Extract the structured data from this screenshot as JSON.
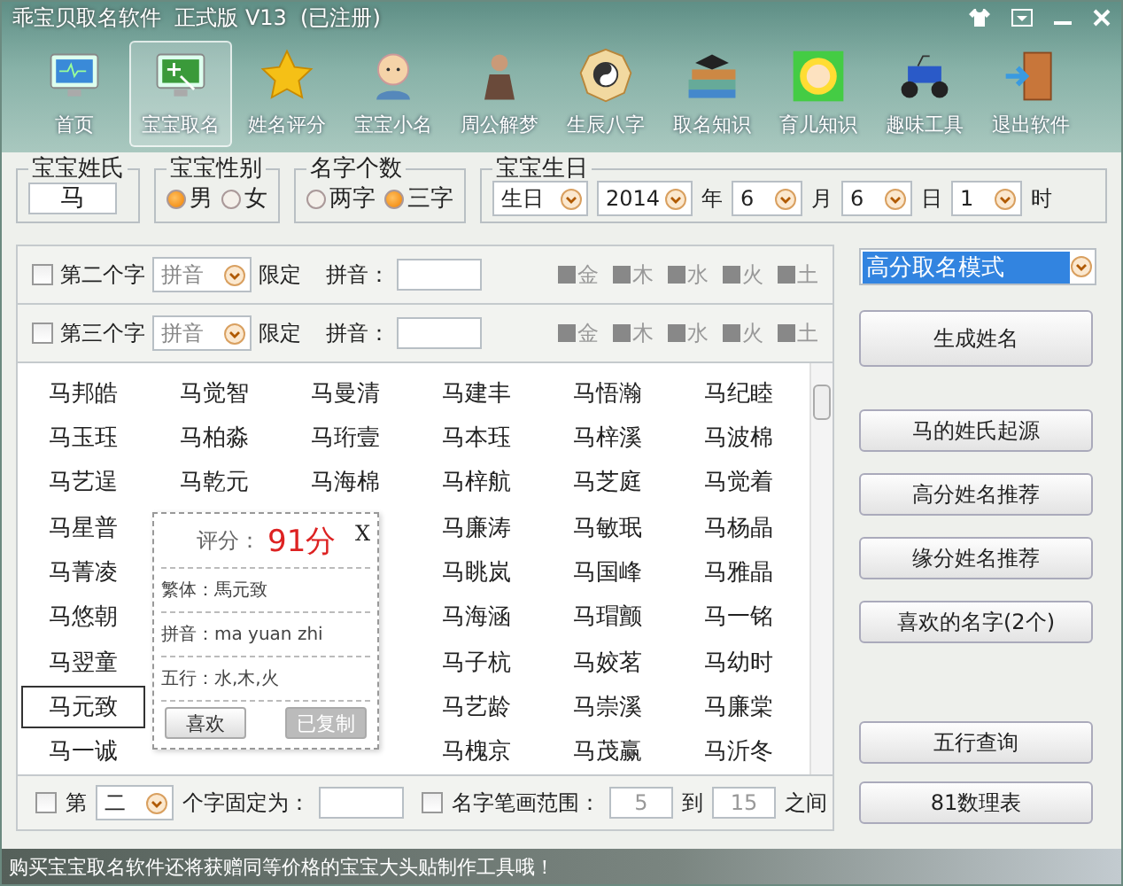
{
  "window": {
    "title": "乖宝贝取名软件  正式版 V13  (已注册)"
  },
  "toolbar": [
    {
      "label": "首页",
      "selected": false
    },
    {
      "label": "宝宝取名",
      "selected": true
    },
    {
      "label": "姓名评分",
      "selected": false
    },
    {
      "label": "宝宝小名",
      "selected": false
    },
    {
      "label": "周公解梦",
      "selected": false
    },
    {
      "label": "生辰八字",
      "selected": false
    },
    {
      "label": "取名知识",
      "selected": false
    },
    {
      "label": "育儿知识",
      "selected": false
    },
    {
      "label": "趣味工具",
      "selected": false
    },
    {
      "label": "退出软件",
      "selected": false
    }
  ],
  "surname": {
    "label": "宝宝姓氏",
    "value": "马"
  },
  "gender": {
    "label": "宝宝性别",
    "options": [
      {
        "label": "男",
        "selected": true
      },
      {
        "label": "女",
        "selected": false
      }
    ]
  },
  "name_length": {
    "label": "名字个数",
    "options": [
      {
        "label": "两字",
        "selected": false
      },
      {
        "label": "三字",
        "selected": true
      }
    ]
  },
  "birthday": {
    "label": "宝宝生日",
    "fields": [
      {
        "value": "生日"
      },
      {
        "value": "2014",
        "unit": "年"
      },
      {
        "value": "6",
        "unit": "月"
      },
      {
        "value": "6",
        "unit": "日"
      },
      {
        "value": "1",
        "unit": "时"
      }
    ]
  },
  "char_filters": [
    {
      "label": "第二个字",
      "checked": false,
      "select": "拼音",
      "limit_label": "限定",
      "pinyin_label": "拼音：",
      "elements": [
        {
          "label": "金",
          "checked": false
        },
        {
          "label": "木",
          "checked": false
        },
        {
          "label": "水",
          "checked": false
        },
        {
          "label": "火",
          "checked": false
        },
        {
          "label": "土",
          "checked": false
        }
      ]
    },
    {
      "label": "第三个字",
      "checked": false,
      "select": "拼音",
      "limit_label": "限定",
      "pinyin_label": "拼音：",
      "elements": [
        {
          "label": "金",
          "checked": false
        },
        {
          "label": "木",
          "checked": false
        },
        {
          "label": "水",
          "checked": false
        },
        {
          "label": "火",
          "checked": false
        },
        {
          "label": "土",
          "checked": false
        }
      ]
    }
  ],
  "names": [
    {
      "cells": [
        {
          "text": "马邦皓",
          "selected": false
        },
        {
          "text": "马觉智",
          "selected": false
        },
        {
          "text": "马曼清",
          "selected": false
        },
        {
          "text": "马建丰",
          "selected": false
        },
        {
          "text": "马悟瀚",
          "selected": false
        },
        {
          "text": "马纪睦",
          "selected": false
        }
      ]
    },
    {
      "cells": [
        {
          "text": "马玉珏",
          "selected": false
        },
        {
          "text": "马柏淼",
          "selected": false
        },
        {
          "text": "马珩壹",
          "selected": false
        },
        {
          "text": "马本珏",
          "selected": false
        },
        {
          "text": "马梓溪",
          "selected": false
        },
        {
          "text": "马波棉",
          "selected": false
        }
      ]
    },
    {
      "cells": [
        {
          "text": "马艺逞",
          "selected": false
        },
        {
          "text": "马乾元",
          "selected": false
        },
        {
          "text": "马海棉",
          "selected": false
        },
        {
          "text": "马梓航",
          "selected": false
        },
        {
          "text": "马芝庭",
          "selected": false
        },
        {
          "text": "马觉着",
          "selected": false
        }
      ]
    },
    {
      "cells": [
        {
          "text": "马星普",
          "selected": false
        },
        null,
        null,
        {
          "text": "马廉涛",
          "selected": false
        },
        {
          "text": "马敏珉",
          "selected": false
        },
        {
          "text": "马杨晶",
          "selected": false
        }
      ]
    },
    {
      "cells": [
        {
          "text": "马菁凌",
          "selected": false
        },
        null,
        null,
        {
          "text": "马眺岚",
          "selected": false
        },
        {
          "text": "马国峰",
          "selected": false
        },
        {
          "text": "马雅晶",
          "selected": false
        }
      ]
    },
    {
      "cells": [
        {
          "text": "马悠朝",
          "selected": false
        },
        null,
        null,
        {
          "text": "马海涵",
          "selected": false
        },
        {
          "text": "马瑁颤",
          "selected": false
        },
        {
          "text": "马一铭",
          "selected": false
        }
      ]
    },
    {
      "cells": [
        {
          "text": "马翌童",
          "selected": false
        },
        null,
        null,
        {
          "text": "马子杭",
          "selected": false
        },
        {
          "text": "马姣茗",
          "selected": false
        },
        {
          "text": "马幼时",
          "selected": false
        }
      ]
    },
    {
      "cells": [
        {
          "text": "马元致",
          "selected": true
        },
        null,
        null,
        {
          "text": "马艺龄",
          "selected": false
        },
        {
          "text": "马崇溪",
          "selected": false
        },
        {
          "text": "马廉棠",
          "selected": false
        }
      ]
    },
    {
      "cells": [
        {
          "text": "马一诚",
          "selected": false
        },
        null,
        null,
        {
          "text": "马槐京",
          "selected": false
        },
        {
          "text": "马茂赢",
          "selected": false
        },
        {
          "text": "马沂冬",
          "selected": false
        }
      ]
    }
  ],
  "popup": {
    "score_label": "评分：",
    "score": "91分",
    "close": "X",
    "lines": [
      "繁体：馬元致",
      "拼音：ma yuan zhi",
      "五行：水,木,火"
    ],
    "buttons": [
      {
        "label": "喜欢",
        "disabled": false
      },
      {
        "label": "已复制",
        "disabled": true
      }
    ]
  },
  "bottom_filter": {
    "fixed_checked": false,
    "fixed_label": "第",
    "fixed_select": "二",
    "fixed_suffix": "个字固定为：",
    "strokes_checked": false,
    "strokes_label": "名字笔画范围：",
    "min": "5",
    "to": "到",
    "max": "15",
    "suffix": "之间"
  },
  "mode_select": "高分取名模式",
  "actions": [
    {
      "label": "生成姓名",
      "kind": "primary"
    },
    {
      "label": "马的姓氏起源",
      "kind": "normal"
    },
    {
      "label": "高分姓名推荐",
      "kind": "normal"
    },
    {
      "label": "缘分姓名推荐",
      "kind": "normal"
    },
    {
      "label": "喜欢的名字(2个)",
      "kind": "normal"
    },
    {
      "label": "五行查询",
      "kind": "lower"
    },
    {
      "label": "81数理表",
      "kind": "normal"
    }
  ],
  "status_bar": "购买宝宝取名软件还将获赠同等价格的宝宝大头贴制作工具哦！"
}
